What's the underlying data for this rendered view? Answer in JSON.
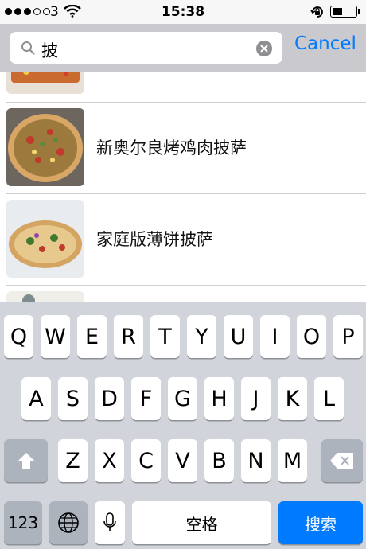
{
  "status_bar": {
    "carrier": "3",
    "time": "15:38",
    "battery_level": 0.45
  },
  "search": {
    "query": "披",
    "cancel_label": "Cancel"
  },
  "results": [
    {
      "title": "新奥尔良烤鸡肉披萨",
      "thumb_icon": "pizza-icon"
    },
    {
      "title": "家庭版薄饼披萨",
      "thumb_icon": "pizza-icon"
    }
  ],
  "keyboard": {
    "row1": [
      "Q",
      "W",
      "E",
      "R",
      "T",
      "Y",
      "U",
      "I",
      "O",
      "P"
    ],
    "row2": [
      "A",
      "S",
      "D",
      "F",
      "G",
      "H",
      "J",
      "K",
      "L"
    ],
    "row3": [
      "Z",
      "X",
      "C",
      "V",
      "B",
      "N",
      "M"
    ],
    "numbers_label": "123",
    "space_label": "空格",
    "search_label": "搜索"
  },
  "colors": {
    "accent": "#007aff",
    "keyboard_bg": "#d1d5db",
    "search_bar_bg": "#c9c9ce"
  }
}
